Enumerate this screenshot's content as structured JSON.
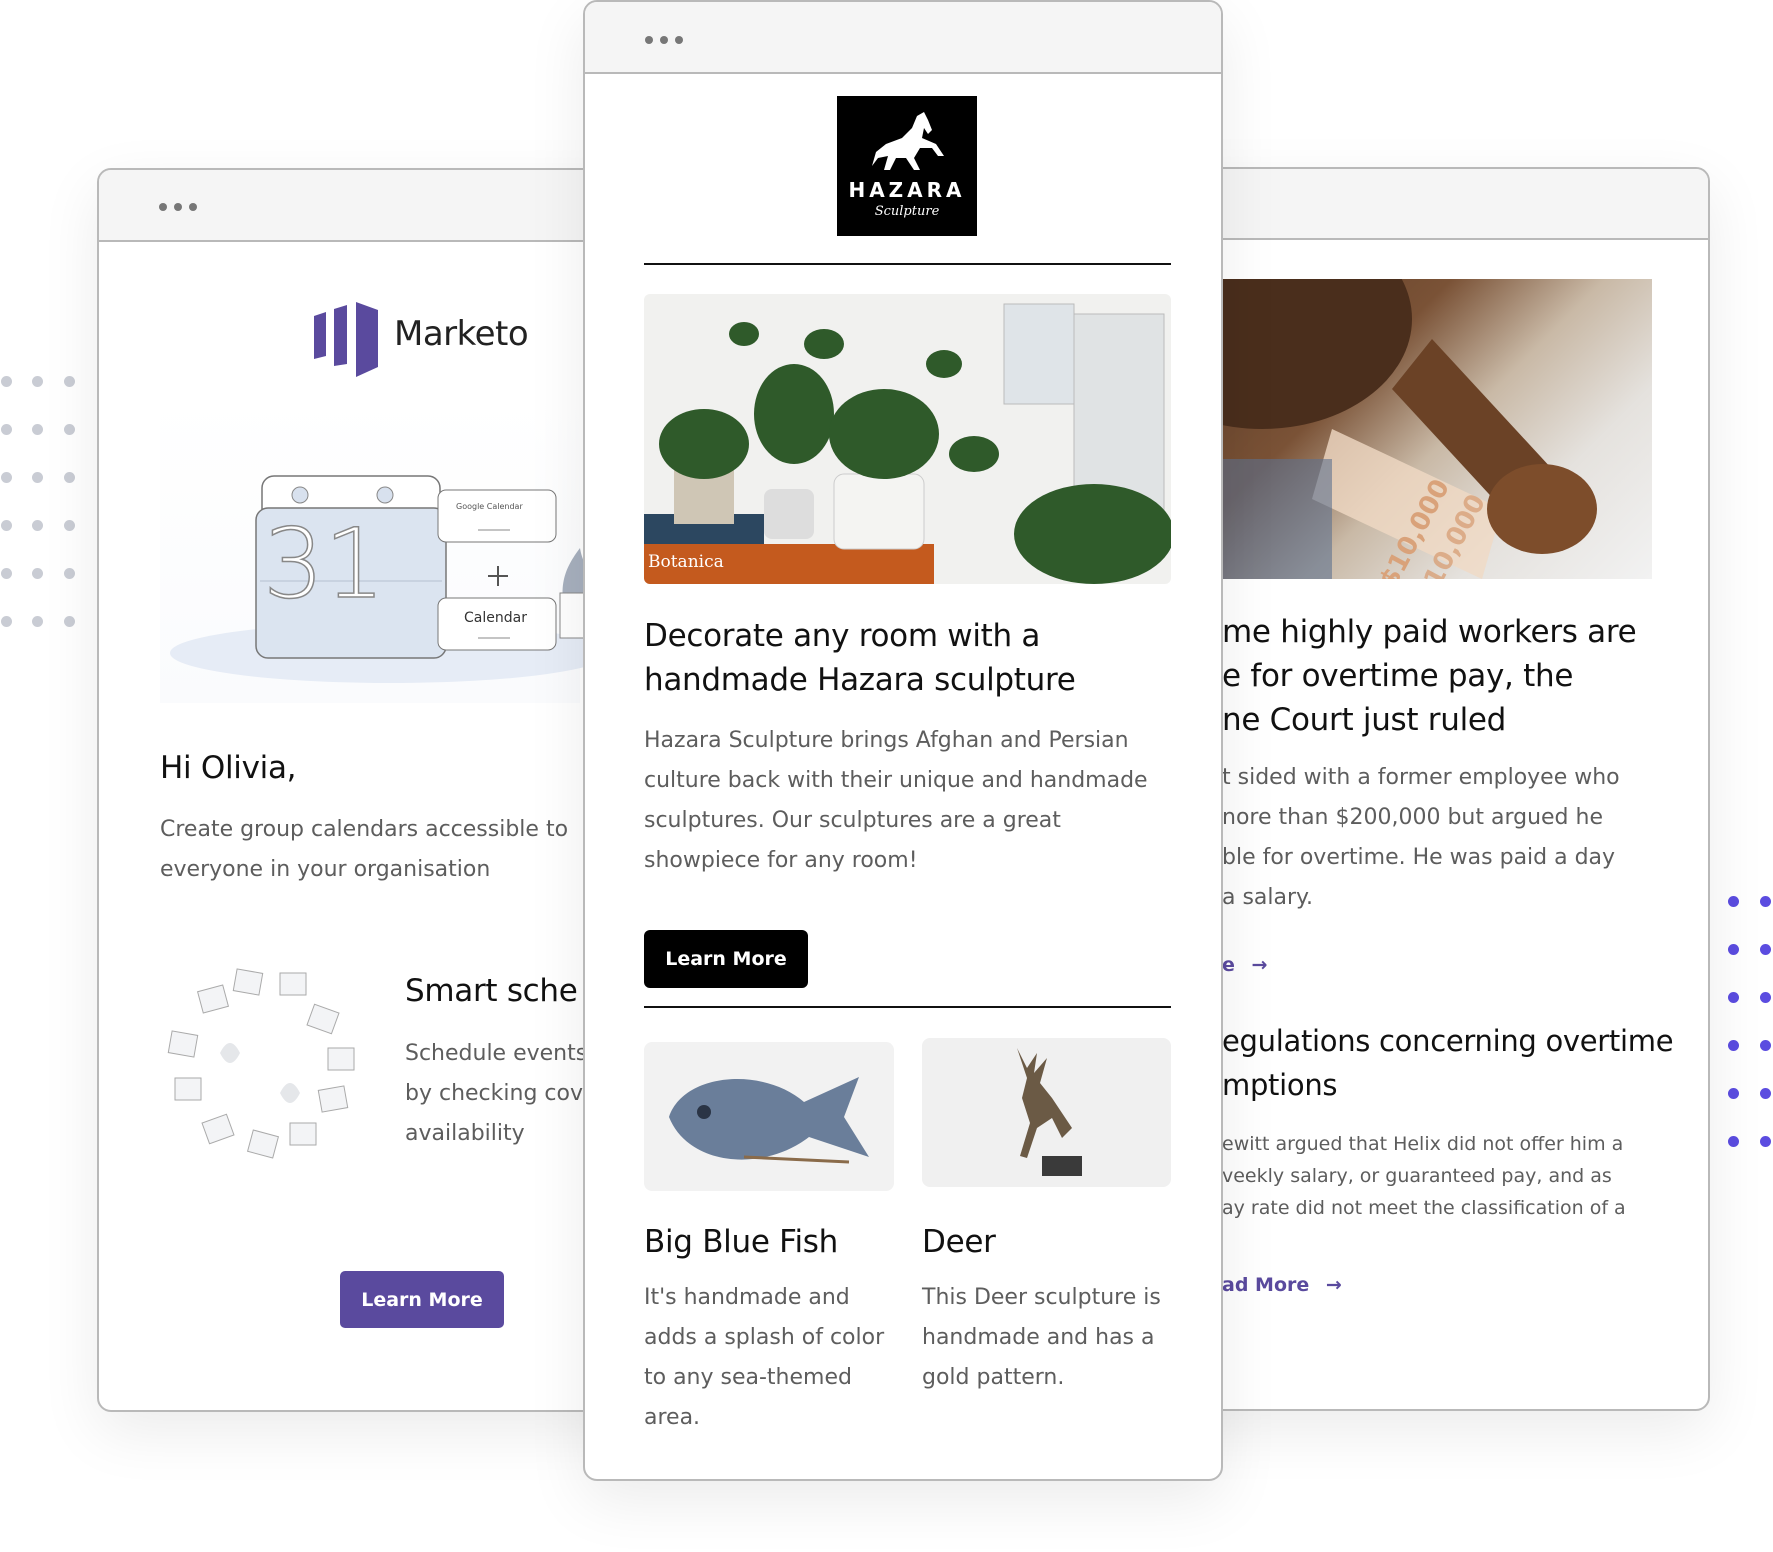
{
  "colors": {
    "accent_purple": "#5a4a9e",
    "dot_purple": "#5b4ce0",
    "dot_gray": "#c9ccd4",
    "black_button": "#000000"
  },
  "left_card": {
    "brand": "Marketo",
    "illustration_labels": {
      "day": "31",
      "google_calendar": "Google Calendar",
      "calendar": "Calendar"
    },
    "greeting": "Hi Olivia,",
    "body_lines": [
      "Create group calendars accessible to",
      "everyone in your organisation"
    ],
    "feature_title": "Smart sche",
    "feature_lines": [
      "Schedule events",
      "by checking cov",
      "availability"
    ],
    "button_label": "Learn More"
  },
  "middle_card": {
    "logo": {
      "name": "HAZARA",
      "tagline": "Sculpture"
    },
    "hero_caption": "Botanica",
    "title_lines": [
      "Decorate any room with a",
      "handmade Hazara sculpture"
    ],
    "body_lines": [
      "Hazara Sculpture brings Afghan and Persian",
      "culture back with their unique and handmade",
      "sculptures. Our sculptures are a great",
      "showpiece for any room!"
    ],
    "button_label": "Learn More",
    "products": [
      {
        "title": "Big Blue Fish",
        "lines": [
          "It's handmade and",
          "adds a splash of color",
          "to any sea-themed",
          "area."
        ]
      },
      {
        "title": "Deer",
        "lines": [
          "This Deer sculpture is",
          "handmade and has a",
          "gold pattern."
        ]
      }
    ]
  },
  "right_card": {
    "image_labels": [
      "$10,000",
      "$10,000"
    ],
    "title_lines": [
      "me highly paid workers are",
      "e for overtime pay, the",
      "ne Court just ruled"
    ],
    "body_lines": [
      "t sided with a former employee who",
      "nore than $200,000 but argued he",
      "ble for overtime. He was paid a day",
      "a salary."
    ],
    "link1_label": "e",
    "title2_lines": [
      "egulations concerning overtime",
      "mptions"
    ],
    "body2_lines": [
      "ewitt argued that Helix did not offer him a",
      "veekly salary, or guaranteed pay, and as",
      "ay rate did not meet the classification of a"
    ],
    "link2_label": "ad More"
  }
}
